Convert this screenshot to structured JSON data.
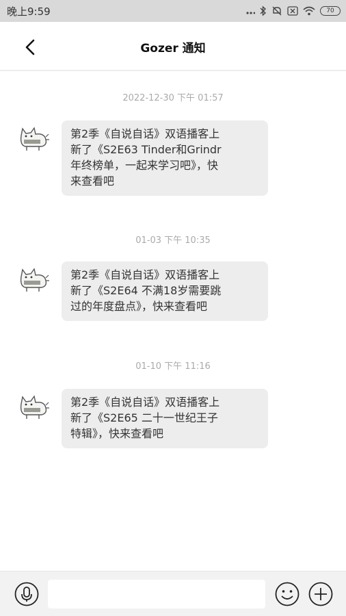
{
  "status_bar": {
    "time": "晚上9:59",
    "battery": "70",
    "icons": [
      "signal-dots-icon",
      "bluetooth-icon",
      "mute-icon",
      "sim-icon",
      "wifi-icon",
      "battery-icon"
    ]
  },
  "header": {
    "title": "Gozer 通知",
    "back_icon": "chevron-left-icon"
  },
  "messages": [
    {
      "timestamp": "2022-12-30 下午 01:57",
      "lines": [
        "第2季《自说自话》双语播客上",
        "新了《S2E63 Tinder和Grindr",
        "年终榜单，一起来学习吧》，快",
        "来查看吧"
      ]
    },
    {
      "timestamp": "01-03 下午 10:35",
      "lines": [
        "第2季《自说自话》双语播客上",
        "新了《S2E64 不满18岁需要跳",
        "过的年度盘点》，快来查看吧"
      ]
    },
    {
      "timestamp": "01-10 下午 11:16",
      "lines": [
        "第2季《自说自话》双语播客上",
        "新了《S2E65 二十一世纪王子",
        "特辑》，快来查看吧"
      ]
    }
  ],
  "input_bar": {
    "text_value": "",
    "icons": [
      "microphone-icon",
      "emoji-icon",
      "plus-icon"
    ]
  },
  "colors": {
    "status_bar_bg": "#d9d9d9",
    "bubble_bg": "#ededed",
    "timestamp_text": "#aaaaaa",
    "input_bar_bg": "#f2f2f2"
  }
}
